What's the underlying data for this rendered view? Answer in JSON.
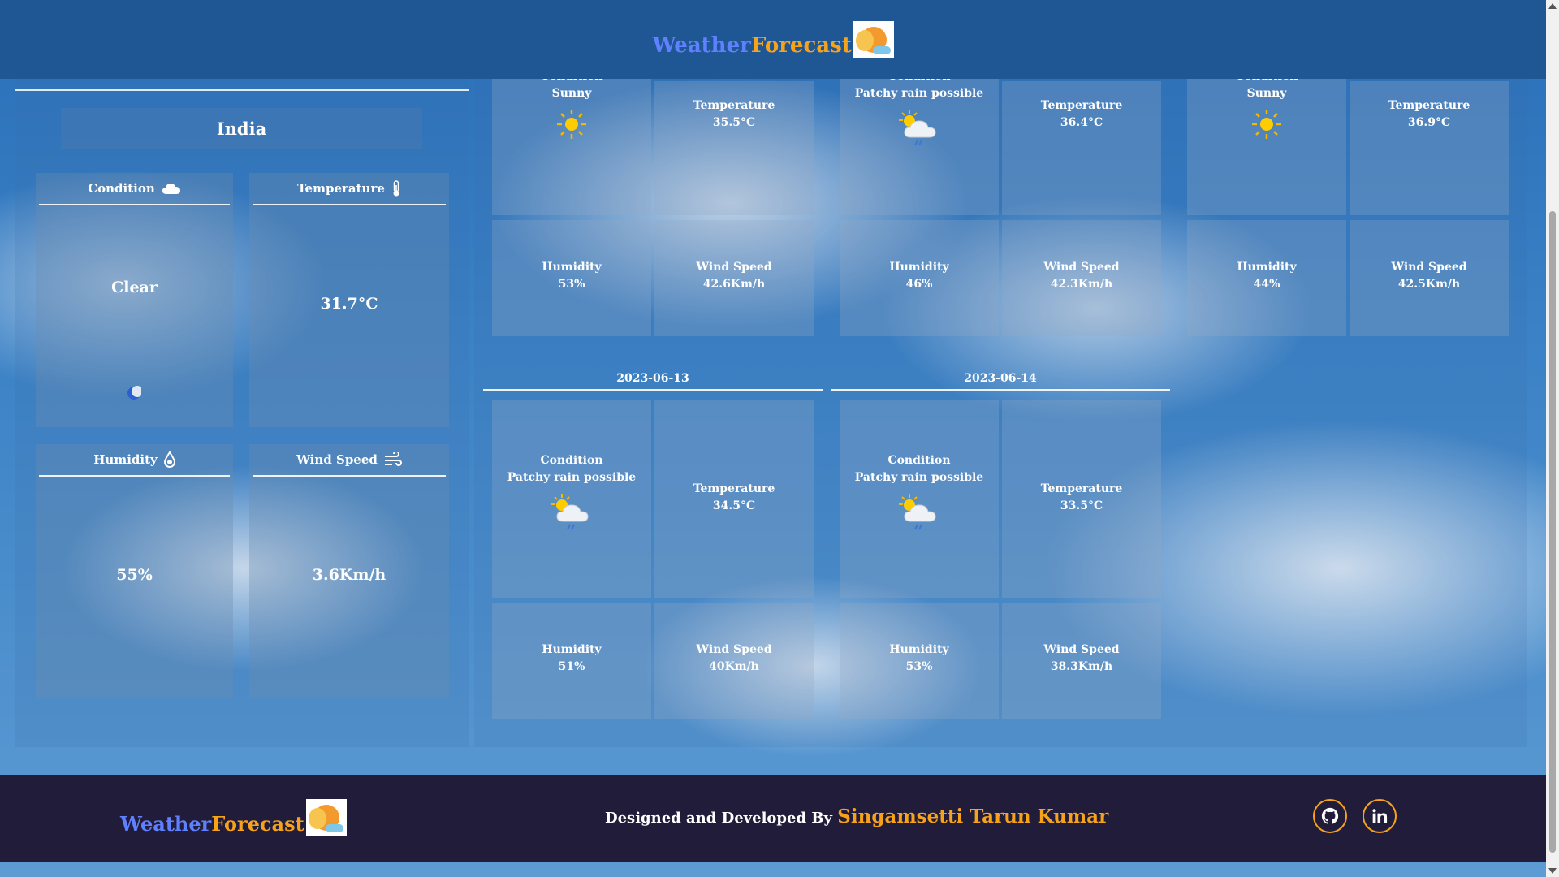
{
  "header": {
    "brand_weather": "Weather",
    "brand_forecast": "Forecast"
  },
  "current": {
    "country": "India",
    "condition": {
      "label": "Condition",
      "value": "Clear"
    },
    "temperature": {
      "label": "Temperature",
      "value": "31.7°C"
    },
    "humidity": {
      "label": "Humidity",
      "value": "55%"
    },
    "wind": {
      "label": "Wind Speed",
      "value": "3.6Km/h"
    }
  },
  "forecast_top": [
    {
      "condition_label": "Condition",
      "condition": "Sunny",
      "icon": "sun-icon",
      "temp_label": "Temperature",
      "temp": "35.5°C",
      "hum_label": "Humidity",
      "humidity": "53%",
      "wind_label": "Wind Speed",
      "wind": "42.6Km/h"
    },
    {
      "condition_label": "Condition",
      "condition": "Patchy rain possible",
      "icon": "patchy-rain-icon",
      "temp_label": "Temperature",
      "temp": "36.4°C",
      "hum_label": "Humidity",
      "humidity": "46%",
      "wind_label": "Wind Speed",
      "wind": "42.3Km/h"
    },
    {
      "condition_label": "Condition",
      "condition": "Sunny",
      "icon": "sun-icon",
      "temp_label": "Temperature",
      "temp": "36.9°C",
      "hum_label": "Humidity",
      "humidity": "44%",
      "wind_label": "Wind Speed",
      "wind": "42.5Km/h"
    }
  ],
  "forecast_bottom": [
    {
      "date": "2023-06-13",
      "condition_label": "Condition",
      "condition": "Patchy rain possible",
      "icon": "patchy-rain-icon",
      "temp_label": "Temperature",
      "temp": "34.5°C",
      "hum_label": "Humidity",
      "humidity": "51%",
      "wind_label": "Wind Speed",
      "wind": "40Km/h"
    },
    {
      "date": "2023-06-14",
      "condition_label": "Condition",
      "condition": "Patchy rain possible",
      "icon": "patchy-rain-icon",
      "temp_label": "Temperature",
      "temp": "33.5°C",
      "hum_label": "Humidity",
      "humidity": "53%",
      "wind_label": "Wind Speed",
      "wind": "38.3Km/h"
    }
  ],
  "footer": {
    "brand_weather": "Weather",
    "brand_forecast": "Forecast",
    "credit_prefix": "Designed and Developed By",
    "credit_name": "Singamsetti Tarun Kumar",
    "social": [
      "github-icon",
      "linkedin-icon"
    ]
  },
  "colors": {
    "header_bg": "#1f5694",
    "footer_bg": "#221c3b",
    "accent_orange": "#f6a21b",
    "accent_blue": "#5f80ff"
  }
}
